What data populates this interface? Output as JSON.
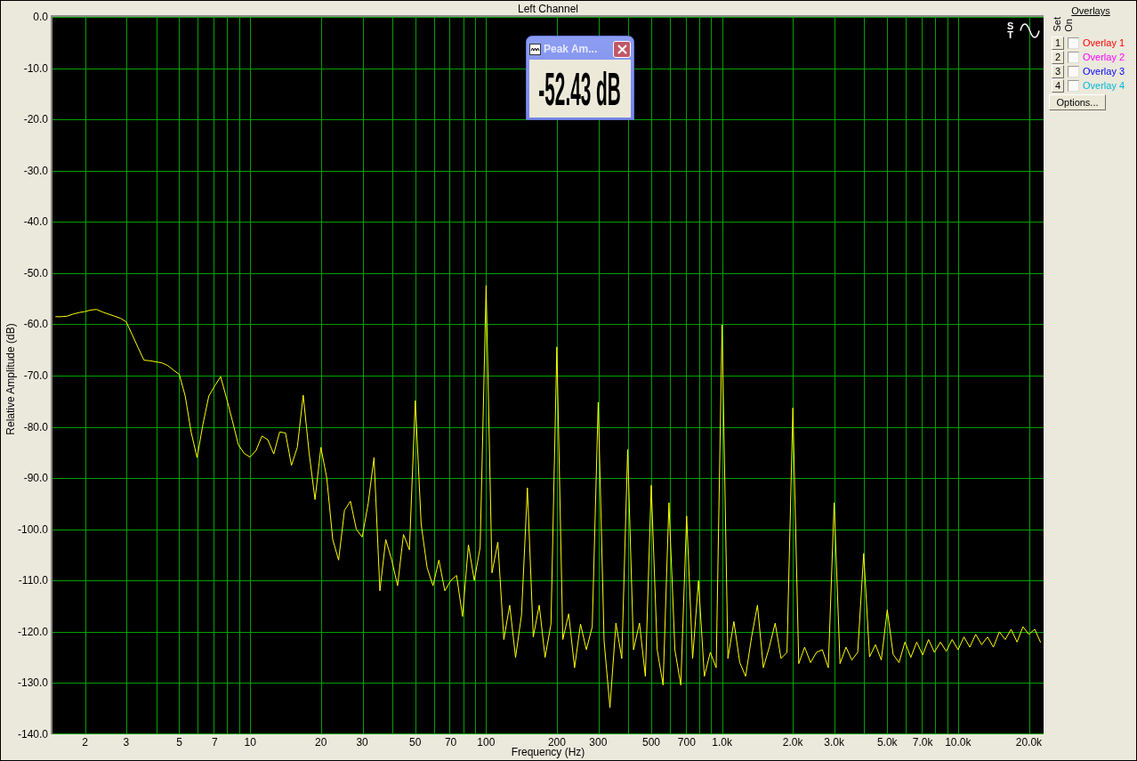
{
  "spectrum": {
    "chart_data": {
      "type": "line",
      "title": "Left Channel",
      "xlabel": "Frequency (Hz)",
      "ylabel": "Relative Amplitude (dB)",
      "grid": true,
      "categories": [
        null,
        null,
        null,
        null,
        null,
        "2",
        null,
        null,
        null,
        null,
        null,
        null,
        "3",
        null,
        null,
        null,
        null,
        null,
        null,
        null,
        null,
        "5",
        null,
        null,
        null,
        null,
        null,
        "7",
        null,
        null,
        null,
        null,
        null,
        "10",
        null,
        null,
        null,
        null,
        null,
        null,
        null,
        null,
        null,
        null,
        null,
        "20",
        null,
        null,
        null,
        null,
        null,
        null,
        "30",
        null,
        null,
        null,
        null,
        null,
        null,
        null,
        null,
        "50",
        null,
        null,
        null,
        null,
        null,
        "70",
        null,
        null,
        null,
        null,
        null,
        "100",
        null,
        null,
        null,
        null,
        null,
        null,
        null,
        null,
        null,
        null,
        null,
        "200",
        null,
        null,
        null,
        null,
        null,
        null,
        "300",
        null,
        null,
        null,
        null,
        null,
        null,
        null,
        null,
        "500",
        null,
        null,
        null,
        null,
        null,
        "700",
        null,
        null,
        null,
        null,
        null,
        "1.0k",
        null,
        null,
        null,
        null,
        null,
        null,
        null,
        null,
        null,
        null,
        null,
        "2.0k",
        null,
        null,
        null,
        null,
        null,
        null,
        "3.0k",
        null,
        null,
        null,
        null,
        null,
        null,
        null,
        null,
        "5.0k",
        null,
        null,
        null,
        null,
        null,
        "7.0k",
        null,
        null,
        null,
        null,
        null,
        "10.0k",
        null,
        null,
        null,
        null,
        null,
        null,
        null,
        null,
        null,
        null,
        null,
        "20.0k",
        null,
        null
      ],
      "series": [
        {
          "color": "#ffff00",
          "values": [
            -58.5,
            -58.5,
            -58.4,
            -58,
            -57.7,
            -57.5,
            -57.2,
            -57.1,
            -57.6,
            -58,
            -58.4,
            -58.8,
            -59.5,
            -62,
            -64.5,
            -67,
            -67.1,
            -67.3,
            -67.5,
            -68,
            -68.9,
            -69.8,
            -74,
            -81,
            -86,
            -79.5,
            -74,
            -72,
            -70.2,
            -74.4,
            -78.8,
            -83.5,
            -85.2,
            -85.9,
            -84.6,
            -81.8,
            -82.5,
            -85.3,
            -81,
            -81.2,
            -87.5,
            -84,
            -73.8,
            -85,
            -94.2,
            -84,
            -90,
            -102,
            -106,
            -96.3,
            -94.5,
            -100,
            -101.5,
            -95,
            -86,
            -112,
            -102,
            -106,
            -111,
            -101,
            -104,
            -74.9,
            -99,
            -107.5,
            -111,
            -106,
            -112,
            -110,
            -109,
            -117,
            -103,
            -110,
            -103.5,
            -52.4,
            -108.5,
            -102.5,
            -121.5,
            -114.8,
            -125,
            -116.7,
            -91.9,
            -121,
            -114.8,
            -125,
            -118.5,
            -64.4,
            -121.5,
            -116.5,
            -127,
            -118.5,
            -123.5,
            -119,
            -75.2,
            -121.8,
            -134.8,
            -118.3,
            -125.2,
            -84.4,
            -123.5,
            -118.3,
            -128.7,
            -91.4,
            -123.5,
            -130.4,
            -94.8,
            -123.5,
            -130.4,
            -97.4,
            -125.2,
            -110,
            -128.7,
            -124,
            -127,
            -60.1,
            -125.2,
            -118,
            -126,
            -128.7,
            -121,
            -114.8,
            -127,
            -123,
            -118.3,
            -125.2,
            -124,
            -76.3,
            -126.2,
            -123,
            -126,
            -124,
            -123.5,
            -127,
            -94.8,
            -126.2,
            -123,
            -125.5,
            -124,
            -104.7,
            -124.9,
            -122.5,
            -125.5,
            -115.7,
            -124.4,
            -126,
            -122,
            -125,
            -122,
            -124.5,
            -121.5,
            -124,
            -122,
            -123.8,
            -121.5,
            -123.5,
            -121,
            -123,
            -120.5,
            -122.5,
            -121,
            -123,
            -120,
            -121.5,
            -119.5,
            -122,
            -119,
            -120.5,
            -119.5,
            -122.1
          ]
        }
      ],
      "ylim": [
        -140,
        0
      ],
      "yticks": [
        {
          "value": 0,
          "label": "0.0"
        },
        {
          "value": -10,
          "label": "-10.0"
        },
        {
          "value": -20,
          "label": "-20.0"
        },
        {
          "value": -30,
          "label": "-30.0"
        },
        {
          "value": -40,
          "label": "-40.0"
        },
        {
          "value": -50,
          "label": "-50.0"
        },
        {
          "value": -60,
          "label": "-60.0"
        },
        {
          "value": -70,
          "label": "-70.0"
        },
        {
          "value": -80,
          "label": "-80.0"
        },
        {
          "value": -90,
          "label": "-90.0"
        },
        {
          "value": -100,
          "label": "-100.0"
        },
        {
          "value": -110,
          "label": "-110.0"
        },
        {
          "value": -120,
          "label": "-120.0"
        },
        {
          "value": -130,
          "label": "-130.0"
        },
        {
          "value": -140,
          "label": "-140.0"
        }
      ]
    }
  },
  "plot_controls": {
    "mode_glyphs": [
      "S",
      "T"
    ]
  },
  "peak_window": {
    "title": "Peak Am...",
    "value": "-52.43 dB"
  },
  "overlays": {
    "title": "Overlays",
    "column_labels": [
      "Set",
      "On"
    ],
    "items": [
      {
        "set_label": "1",
        "checked": false,
        "name": "Overlay 1",
        "color": "#ff0000"
      },
      {
        "set_label": "2",
        "checked": false,
        "name": "Overlay 2",
        "color": "#ff00ff"
      },
      {
        "set_label": "3",
        "checked": false,
        "name": "Overlay 3",
        "color": "#0000ff"
      },
      {
        "set_label": "4",
        "checked": false,
        "name": "Overlay 4",
        "color": "#00b8d8"
      }
    ],
    "options_button": "Options..."
  }
}
